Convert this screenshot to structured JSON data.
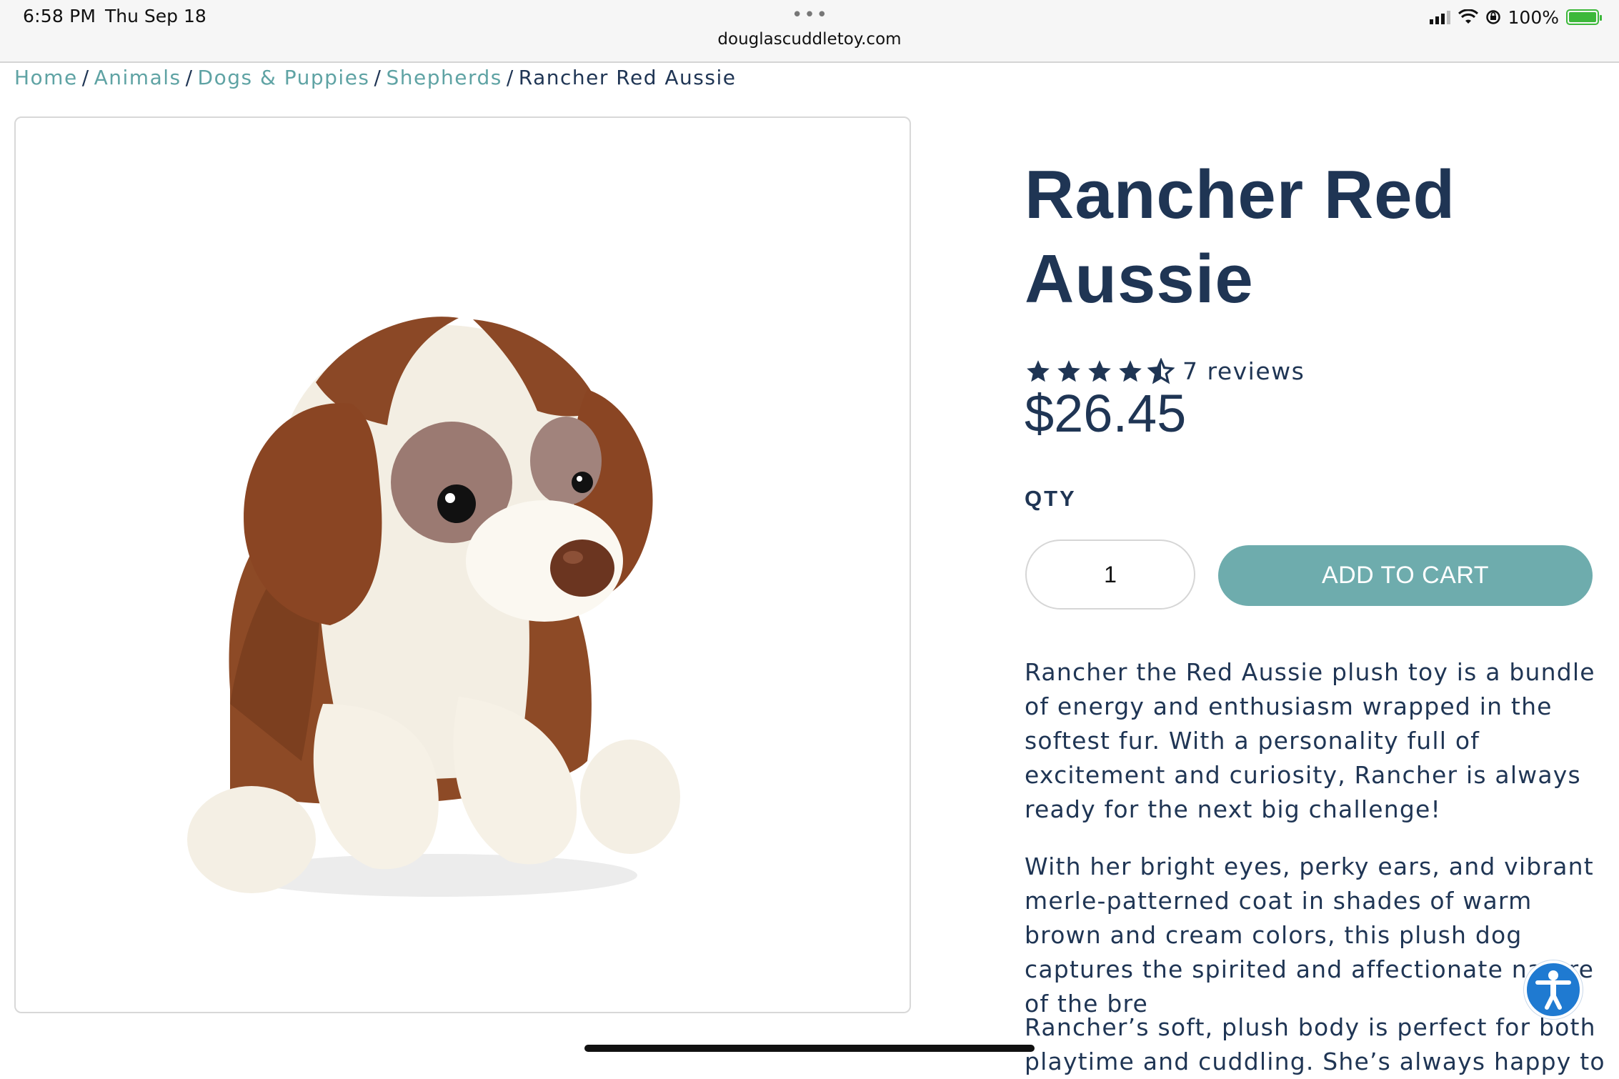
{
  "status_bar": {
    "time": "6:58 PM",
    "date": "Thu Sep 18",
    "url": "douglascuddletoy.com",
    "battery": "100%",
    "icons": [
      "signal-icon",
      "wifi-icon",
      "orientation-lock-icon",
      "battery-icon"
    ]
  },
  "breadcrumb": {
    "items": [
      "Home",
      "Animals",
      "Dogs & Puppies",
      "Shepherds"
    ],
    "current": "Rancher Red Aussie",
    "separator": "/"
  },
  "product": {
    "title_line1": "Rancher Red",
    "title_line2": "Aussie",
    "rating": 4.5,
    "reviews": "7 reviews",
    "price": "$26.45",
    "qty_label": "QTY",
    "qty_value": "1",
    "add_to_cart": "ADD TO CART",
    "description": [
      "Rancher the Red Aussie plush toy is a bundle of energy and enthusiasm wrapped in the softest fur. With a personality full of excitement and curiosity, Rancher is always ready for the next big challenge!",
      "With her bright eyes, perky ears, and vibrant merle-patterned coat in shades of warm brown and cream colors, this plush dog captures the spirited and affectionate nature of the bre",
      "Rancher’s soft, plush body is perfect for both playtime and cuddling. She’s always happy to"
    ]
  },
  "colors": {
    "navy": "#1f3554",
    "teal_link": "#5fa3a4",
    "button": "#6eacad",
    "accessibility": "#1f7ad1"
  }
}
